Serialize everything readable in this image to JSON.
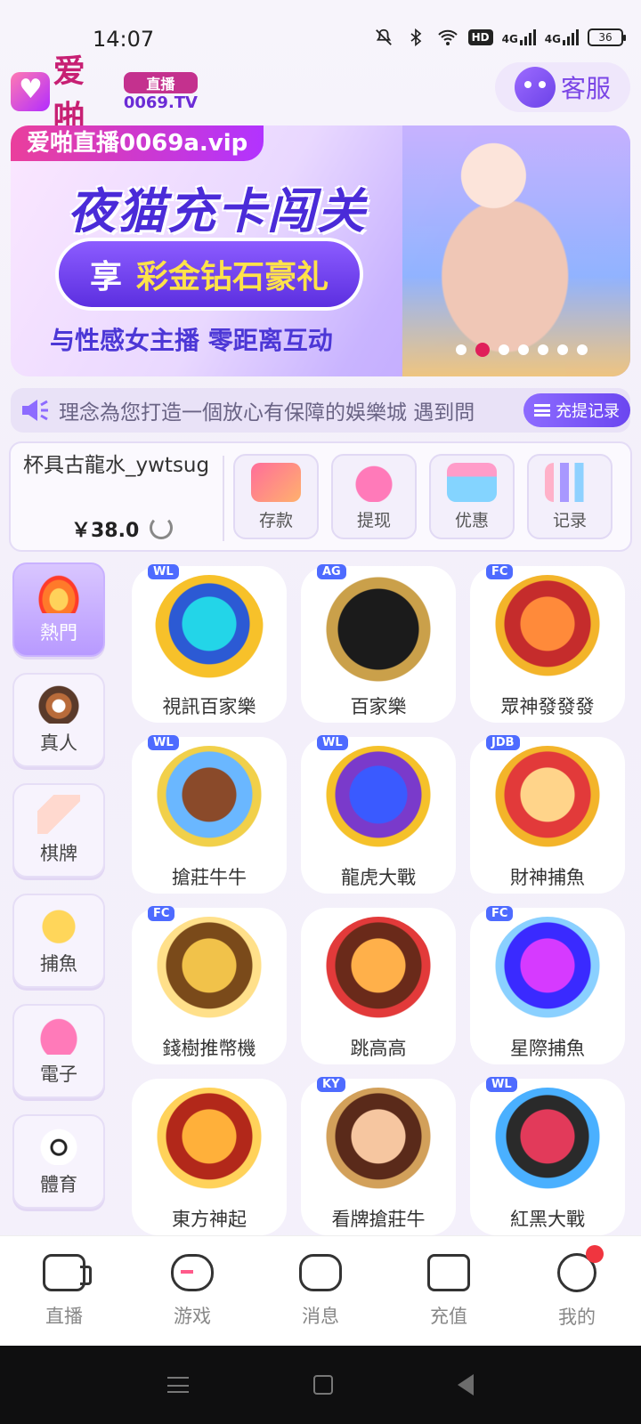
{
  "status_bar": {
    "time": "14:07",
    "hd_badge": "HD",
    "net_1": "4G",
    "net_2": "4G",
    "battery": "36",
    "icons": [
      "mute-icon",
      "bluetooth-icon",
      "wifi-icon",
      "signal-icon",
      "signal-icon",
      "battery-icon"
    ]
  },
  "header": {
    "logo_text": "爱啪",
    "logo_live": "直播",
    "logo_domain": "0069.TV",
    "service_label": "客服"
  },
  "banner": {
    "tag": "爱啪直播0069a.vip",
    "title": "夜猫充卡闯关",
    "pill_left": "享",
    "pill_right": "彩金钻石豪礼",
    "subtitle": "与性感女主播 零距离互动",
    "dots_total": 7,
    "active_dot": 2
  },
  "notice": {
    "text": "理念為您打造一個放心有保障的娛樂城 遇到問",
    "button": "充提记录"
  },
  "account": {
    "username": "杯具古龍水_ywtsug",
    "balance": "￥38.0",
    "actions": [
      {
        "label": "存款",
        "icon": "card-icon"
      },
      {
        "label": "提现",
        "icon": "money-bag-icon"
      },
      {
        "label": "优惠",
        "icon": "gift-icon"
      },
      {
        "label": "记录",
        "icon": "chart-icon"
      }
    ]
  },
  "categories": [
    {
      "label": "熱門",
      "icon": "fire-icon",
      "active": true
    },
    {
      "label": "真人",
      "icon": "chip-icon",
      "active": false
    },
    {
      "label": "棋牌",
      "icon": "cards-icon",
      "active": false
    },
    {
      "label": "捕魚",
      "icon": "fish-icon",
      "active": false
    },
    {
      "label": "電子",
      "icon": "slot-icon",
      "active": false
    },
    {
      "label": "體育",
      "icon": "ball-icon",
      "active": false
    }
  ],
  "games": [
    {
      "label": "視訊百家樂",
      "tag": "WL"
    },
    {
      "label": "百家樂",
      "tag": "AG"
    },
    {
      "label": "眾神發發發",
      "tag": "FC"
    },
    {
      "label": "搶莊牛牛",
      "tag": "WL"
    },
    {
      "label": "龍虎大戰",
      "tag": "WL"
    },
    {
      "label": "財神捕魚",
      "tag": "JDB"
    },
    {
      "label": "錢樹推幣機",
      "tag": "FC"
    },
    {
      "label": "跳高高",
      "tag": ""
    },
    {
      "label": "星際捕魚",
      "tag": "FC"
    },
    {
      "label": "東方神起",
      "tag": ""
    },
    {
      "label": "看牌搶莊牛",
      "tag": "KY"
    },
    {
      "label": "紅黑大戰",
      "tag": "WL"
    }
  ],
  "bottom_nav": [
    {
      "label": "直播",
      "icon": "camera-icon"
    },
    {
      "label": "游戏",
      "icon": "gamepad-icon"
    },
    {
      "label": "消息",
      "icon": "message-icon"
    },
    {
      "label": "充值",
      "icon": "wallet-icon"
    },
    {
      "label": "我的",
      "icon": "profile-icon",
      "badge": true
    }
  ]
}
